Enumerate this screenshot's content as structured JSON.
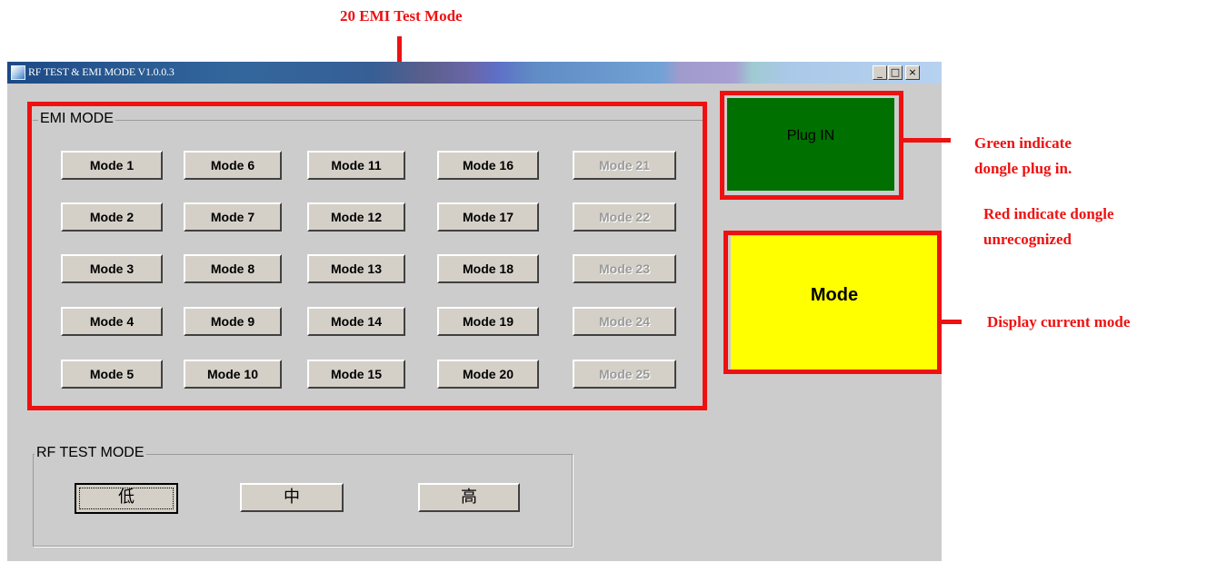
{
  "annotations": {
    "top_title": "20 EMI Test Mode",
    "plug_note_line1": "Green indicate",
    "plug_note_line2": "dongle plug in.",
    "red_note_line1": "Red indicate dongle",
    "red_note_line2": "unrecognized",
    "mode_note": "Display current mode",
    "color": "#ee1111"
  },
  "window": {
    "title": "RF TEST & EMI MODE V1.0.0.3",
    "controls": {
      "minimize": "_",
      "maximize": "□",
      "close": "×"
    }
  },
  "emi": {
    "legend": "EMI MODE",
    "buttons": [
      {
        "label": "Mode 1",
        "enabled": true
      },
      {
        "label": "Mode 6",
        "enabled": true
      },
      {
        "label": "Mode 11",
        "enabled": true
      },
      {
        "label": "Mode 16",
        "enabled": true
      },
      {
        "label": "Mode 21",
        "enabled": false
      },
      {
        "label": "Mode 2",
        "enabled": true
      },
      {
        "label": "Mode 7",
        "enabled": true
      },
      {
        "label": "Mode 12",
        "enabled": true
      },
      {
        "label": "Mode 17",
        "enabled": true
      },
      {
        "label": "Mode 22",
        "enabled": false
      },
      {
        "label": "Mode 3",
        "enabled": true
      },
      {
        "label": "Mode 8",
        "enabled": true
      },
      {
        "label": "Mode 13",
        "enabled": true
      },
      {
        "label": "Mode 18",
        "enabled": true
      },
      {
        "label": "Mode 23",
        "enabled": false
      },
      {
        "label": "Mode 4",
        "enabled": true
      },
      {
        "label": "Mode 9",
        "enabled": true
      },
      {
        "label": "Mode 14",
        "enabled": true
      },
      {
        "label": "Mode 19",
        "enabled": true
      },
      {
        "label": "Mode 24",
        "enabled": false
      },
      {
        "label": "Mode 5",
        "enabled": true
      },
      {
        "label": "Mode 10",
        "enabled": true
      },
      {
        "label": "Mode 15",
        "enabled": true
      },
      {
        "label": "Mode 20",
        "enabled": true
      },
      {
        "label": "Mode 25",
        "enabled": false
      }
    ]
  },
  "rf": {
    "legend": "RF TEST MODE",
    "low": "低",
    "mid": "中",
    "high": "高"
  },
  "status": {
    "plug_label": "Plug IN",
    "plug_color": "#007000",
    "mode_label": "Mode",
    "mode_color": "#ffff00"
  }
}
